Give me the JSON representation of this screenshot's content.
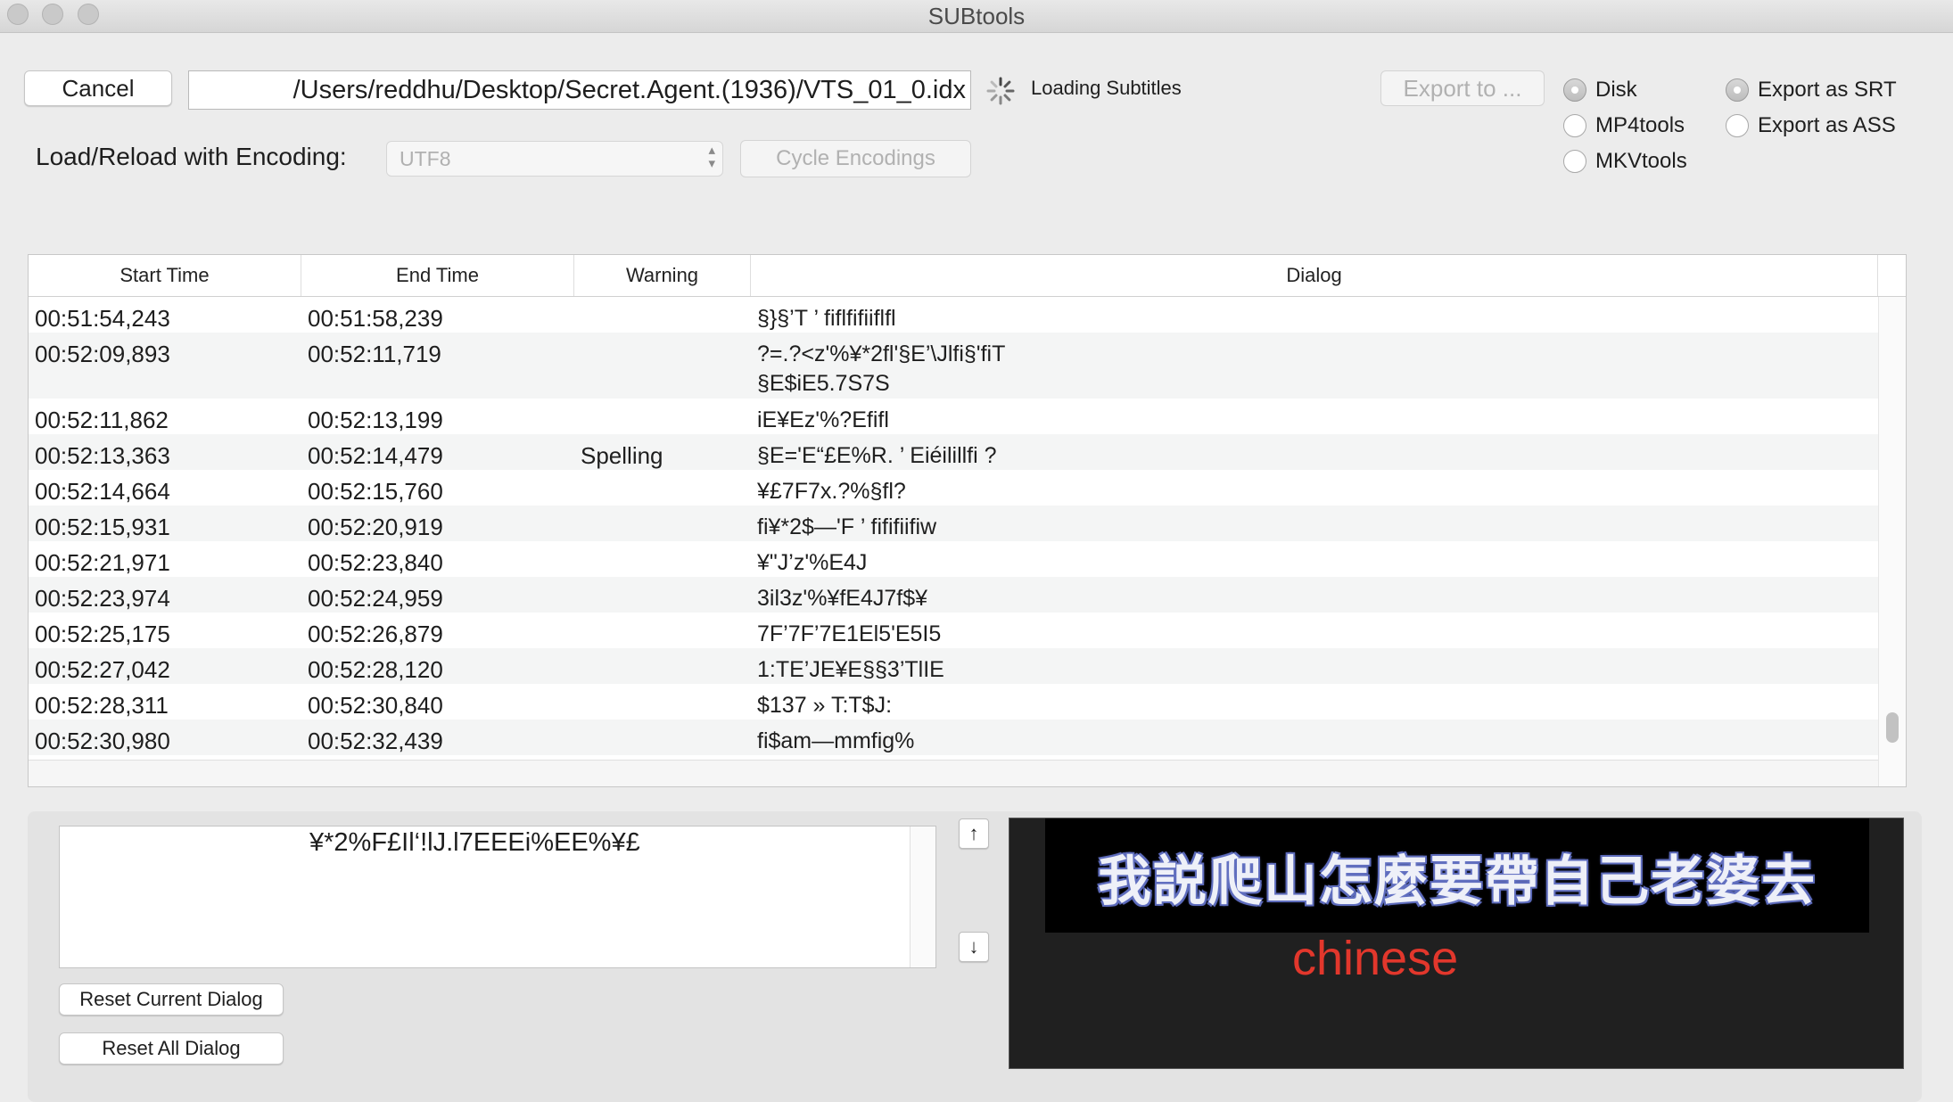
{
  "window": {
    "title": "SUBtools"
  },
  "toolbar": {
    "cancel_label": "Cancel",
    "file_path": "/Users/reddhu/Desktop/Secret.Agent.(1936)/VTS_01_0.idx",
    "loading_label": "Loading Subtitles",
    "export_label": "Export to ...",
    "encoding_label": "Load/Reload with Encoding:",
    "encoding_value": "UTF8",
    "cycle_label": "Cycle Encodings"
  },
  "destination": {
    "options": [
      {
        "label": "Disk",
        "selected": true
      },
      {
        "label": "MP4tools",
        "selected": false
      },
      {
        "label": "MKVtools",
        "selected": false
      }
    ]
  },
  "format": {
    "options": [
      {
        "label": "Export as SRT",
        "selected": true
      },
      {
        "label": "Export as ASS",
        "selected": false
      }
    ]
  },
  "table": {
    "headers": [
      "Start Time",
      "End Time",
      "Warning",
      "Dialog"
    ],
    "rows": [
      {
        "start": "00:51:54,243",
        "end": "00:51:58,239",
        "warning": "",
        "dialog": [
          "§}§’T ’ fiflfifiiflfl"
        ]
      },
      {
        "start": "00:52:09,893",
        "end": "00:52:11,719",
        "warning": "",
        "dialog": [
          "?=.?<z'%¥*2fl'§E’\\Jlfi§'fiT",
          "§E$iE5.7S7S"
        ]
      },
      {
        "start": "00:52:11,862",
        "end": "00:52:13,199",
        "warning": "",
        "dialog": [
          "iE¥Ez'%?Efifl"
        ]
      },
      {
        "start": "00:52:13,363",
        "end": "00:52:14,479",
        "warning": "Spelling",
        "dialog": [
          "§E='E“£E%R. ’ Eiéilillfi ?"
        ]
      },
      {
        "start": "00:52:14,664",
        "end": "00:52:15,760",
        "warning": "",
        "dialog": [
          "¥£7F7x.?%§fl?"
        ]
      },
      {
        "start": "00:52:15,931",
        "end": "00:52:20,919",
        "warning": "",
        "dialog": [
          "fi¥*2$—'F ’ fififiifiw"
        ]
      },
      {
        "start": "00:52:21,971",
        "end": "00:52:23,840",
        "warning": "",
        "dialog": [
          "¥\"J’z'%E4J"
        ]
      },
      {
        "start": "00:52:23,974",
        "end": "00:52:24,959",
        "warning": "",
        "dialog": [
          "3il3z'%¥fE4J7f$¥"
        ]
      },
      {
        "start": "00:52:25,175",
        "end": "00:52:26,879",
        "warning": "",
        "dialog": [
          "7F’7F’7E1El5'E5I5"
        ]
      },
      {
        "start": "00:52:27,042",
        "end": "00:52:28,120",
        "warning": "",
        "dialog": [
          "1:TE’JE¥E§§3’TlIE"
        ]
      },
      {
        "start": "00:52:28,311",
        "end": "00:52:30,840",
        "warning": "",
        "dialog": [
          "$137 » T:T$J:"
        ]
      },
      {
        "start": "00:52:30,980",
        "end": "00:52:32,439",
        "warning": "",
        "dialog": [
          "fi$am—mmfig%"
        ]
      }
    ]
  },
  "editor": {
    "current_text": "¥*2%F£Il‘!lJ.l7EEEi%EE%¥£",
    "reset_current_label": "Reset Current Dialog",
    "reset_all_label": "Reset All Dialog",
    "up_arrow": "↑",
    "down_arrow": "↓"
  },
  "preview": {
    "subtitle_text": "我説爬山怎麼要帶自己老婆去",
    "language_label": "chinese"
  },
  "icons": {
    "traffic_lights": [
      "close-icon",
      "minimize-icon",
      "zoom-icon"
    ],
    "spinner": "spinner-icon",
    "select_arrows": "chevron-updown-icon"
  },
  "colors": {
    "language_label": "#e2372c",
    "subtitle_glow": "#5a68b8"
  }
}
